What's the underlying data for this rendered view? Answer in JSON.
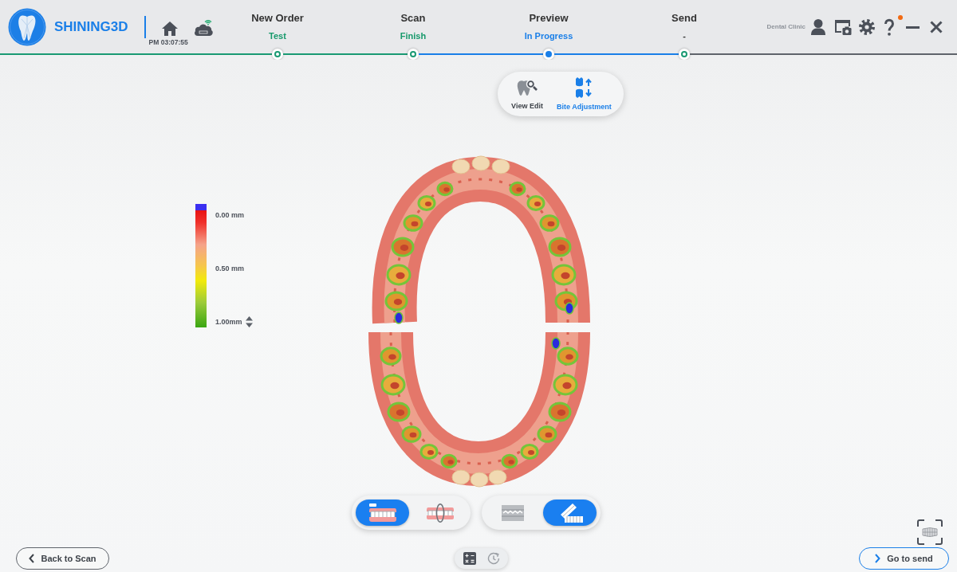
{
  "header": {
    "logo": "SHINING3D",
    "clock": "PM 03:07:55",
    "user": "Dental Clinic",
    "help_badge": true
  },
  "steps": [
    {
      "title": "New Order",
      "status": "Test",
      "done": true,
      "current": false
    },
    {
      "title": "Scan",
      "status": "Finish",
      "done": true,
      "current": false
    },
    {
      "title": "Preview",
      "status": "In Progress",
      "done": false,
      "current": true
    },
    {
      "title": "Send",
      "status": "-",
      "done": false,
      "current": false
    }
  ],
  "view_tabs": [
    {
      "label": "View Edit",
      "selected": false
    },
    {
      "label": "Bite Adjustment",
      "selected": true
    }
  ],
  "distance_legend": {
    "labels": [
      "0.00 mm",
      "0.50 mm",
      "1.00mm"
    ]
  },
  "display_toggles": [
    {
      "buttons": [
        {
          "selected": true
        },
        {
          "selected": false
        }
      ]
    },
    {
      "buttons": [
        {
          "selected": false
        },
        {
          "selected": true
        }
      ]
    }
  ],
  "footer": {
    "back_button": "Back to Scan",
    "next_button": "Go to send"
  }
}
